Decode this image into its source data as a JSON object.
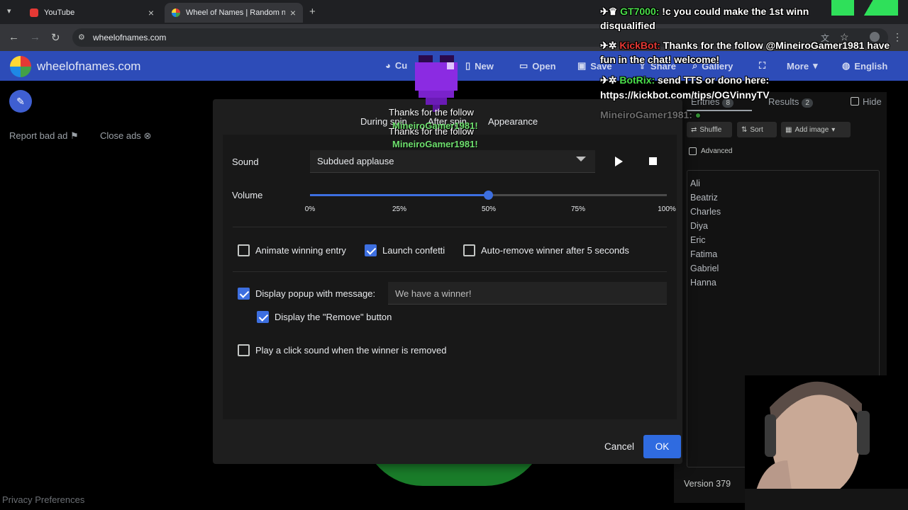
{
  "browser": {
    "tabs": [
      {
        "title": "YouTube",
        "active": false
      },
      {
        "title": "Wheel of Names | Random nam",
        "active": true
      }
    ],
    "url": "wheelofnames.com",
    "new_tab_symbol": "+",
    "close_symbol": "×"
  },
  "site": {
    "name": "wheelofnames.com",
    "nav": [
      "Cu",
      "New",
      "Open",
      "Save",
      "Share",
      "Gallery",
      "More",
      "English"
    ]
  },
  "left": {
    "report_ad": "Report bad ad",
    "close_ads": "Close ads",
    "privacy": "Privacy Preferences"
  },
  "right_panel": {
    "tab_entries": "Entries",
    "entries_count": "8",
    "tab_results": "Results",
    "results_count": "2",
    "hide_label": "Hide",
    "shuffle": "Shuffle",
    "sort": "Sort",
    "add_image": "Add image",
    "advanced": "Advanced",
    "entries": [
      "Ali",
      "Beatriz",
      "Charles",
      "Diya",
      "Eric",
      "Fatima",
      "Gabriel",
      "Hanna"
    ],
    "version": "Version 379"
  },
  "modal": {
    "tabs": {
      "during_spin": "During spin",
      "after_spin": "After spin",
      "appearance": "Appearance"
    },
    "sound_label": "Sound",
    "sound_value": "Subdued applause",
    "volume_label": "Volume",
    "volume_value": 0.5,
    "volume_ticks": [
      "0%",
      "25%",
      "50%",
      "75%",
      "100%"
    ],
    "animate_winning": {
      "label": "Animate winning entry",
      "checked": false
    },
    "launch_confetti": {
      "label": "Launch confetti",
      "checked": true
    },
    "auto_remove": {
      "label": "Auto-remove winner after 5 seconds",
      "checked": false
    },
    "display_popup": {
      "label": "Display popup with message:",
      "checked": true
    },
    "popup_message": "We have a winner!",
    "display_remove": {
      "label": "Display the \"Remove\" button",
      "checked": true
    },
    "click_sound": {
      "label": "Play a click sound when the winner is removed",
      "checked": false
    },
    "cancel": "Cancel",
    "ok": "OK"
  },
  "overlay": {
    "chat": [
      {
        "user": "GT7000:",
        "message": " !c you could make the 1st winn",
        "tail": "disqualified",
        "user_color": "#4ade4a"
      },
      {
        "user": "KickBot:",
        "message": " Thanks for the follow @MineiroGamer1981 have",
        "tail": "fun in the chat! welcome!",
        "user_color": "#e53935"
      },
      {
        "user": "BotRix:",
        "message": " send TTS or dono here:",
        "tail": "https://kickbot.com/tips/OGVinnyTV",
        "user_color": "#4ade4a"
      },
      {
        "user": "MineiroGamer1981:",
        "message": "",
        "tail": "",
        "user_color": "#9e9e9e"
      }
    ],
    "alert_line1": "Thanks for the follow",
    "alert_name": "MineiroGamer1981!",
    "alert_line2": "Thanks for the follow",
    "alert_name2": "MineiroGamer1981!"
  },
  "colors": {
    "header_blue": "#2d4cb8",
    "accent_blue": "#3d6fe0",
    "ok_blue": "#2f6be0"
  }
}
